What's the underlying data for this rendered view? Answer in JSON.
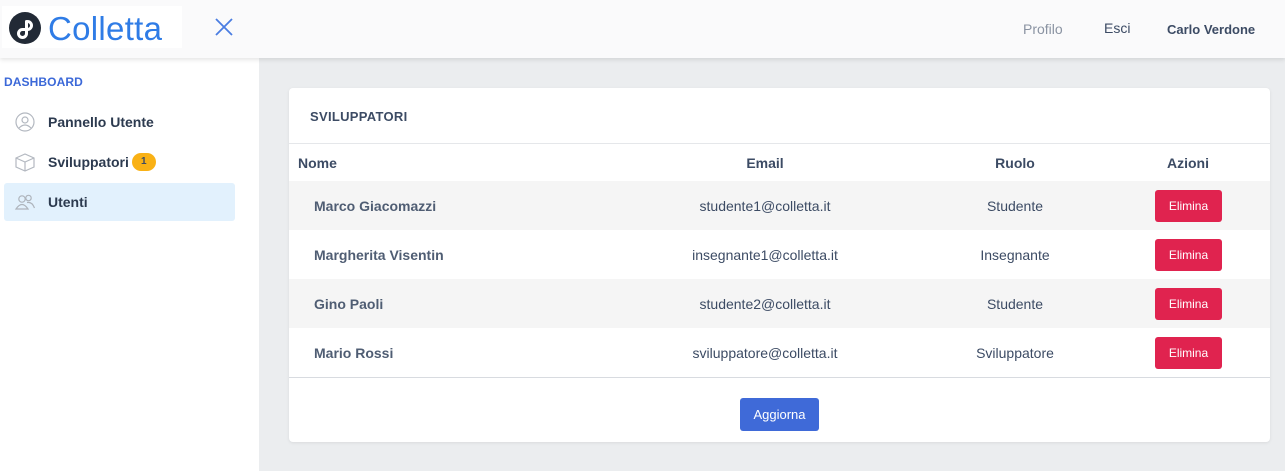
{
  "header": {
    "brand": "Colletta",
    "nav": {
      "profile": "Profilo",
      "logout": "Esci",
      "user": "Carlo Verdone"
    }
  },
  "sidebar": {
    "title": "DASHBOARD",
    "items": [
      {
        "label": "Pannello Utente",
        "icon": "user-icon"
      },
      {
        "label": "Sviluppatori",
        "icon": "box-icon",
        "badge": "1"
      },
      {
        "label": "Utenti",
        "icon": "users-icon",
        "active": true
      }
    ]
  },
  "card": {
    "title": "SVILUPPATORI",
    "columns": {
      "name": "Nome",
      "email": "Email",
      "role": "Ruolo",
      "actions": "Azioni"
    },
    "rows": [
      {
        "name": "Marco Giacomazzi",
        "email": "studente1@colletta.it",
        "role": "Studente",
        "action": "Elimina"
      },
      {
        "name": "Margherita Visentin",
        "email": "insegnante1@colletta.it",
        "role": "Insegnante",
        "action": "Elimina"
      },
      {
        "name": "Gino Paoli",
        "email": "studente2@colletta.it",
        "role": "Studente",
        "action": "Elimina"
      },
      {
        "name": "Mario Rossi",
        "email": "sviluppatore@colletta.it",
        "role": "Sviluppatore",
        "action": "Elimina"
      }
    ],
    "refresh_label": "Aggiorna"
  },
  "colors": {
    "brand": "#2f7ce6",
    "danger": "#e0234f",
    "primary": "#3f6ad8",
    "badge": "#f9b115",
    "active_item": "#e2f1fd"
  }
}
